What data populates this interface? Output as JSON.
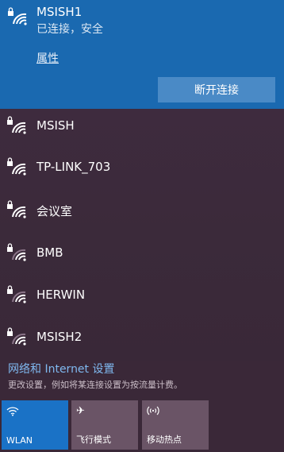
{
  "connected": {
    "ssid": "MSISH1",
    "status": "已连接，安全",
    "properties_link": "属性",
    "disconnect_label": "断开连接"
  },
  "networks": [
    {
      "name": "MSISH",
      "icon": "wifi-secured-icon"
    },
    {
      "name": "TP-LINK_703",
      "icon": "wifi-secured-icon"
    },
    {
      "name": "会议室",
      "icon": "wifi-secured-icon"
    },
    {
      "name": "BMB",
      "icon": "wifi-secured-weak-icon"
    },
    {
      "name": "HERWIN",
      "icon": "wifi-secured-weak-icon"
    },
    {
      "name": "MSISH2",
      "icon": "wifi-secured-weak-icon"
    }
  ],
  "footer": {
    "settings_link": "网络和 Internet 设置",
    "description": "更改设置，例如将某连接设置为按流量计费。"
  },
  "quick_actions": [
    {
      "label": "WLAN",
      "icon": "wifi-icon",
      "active": true
    },
    {
      "label": "飞行模式",
      "icon": "airplane-icon",
      "active": false
    },
    {
      "label": "移动热点",
      "icon": "hotspot-icon",
      "active": false
    }
  ],
  "colors": {
    "accent": "#1a69b0",
    "tile_active": "#1a72c6",
    "background": "#3a2838"
  }
}
